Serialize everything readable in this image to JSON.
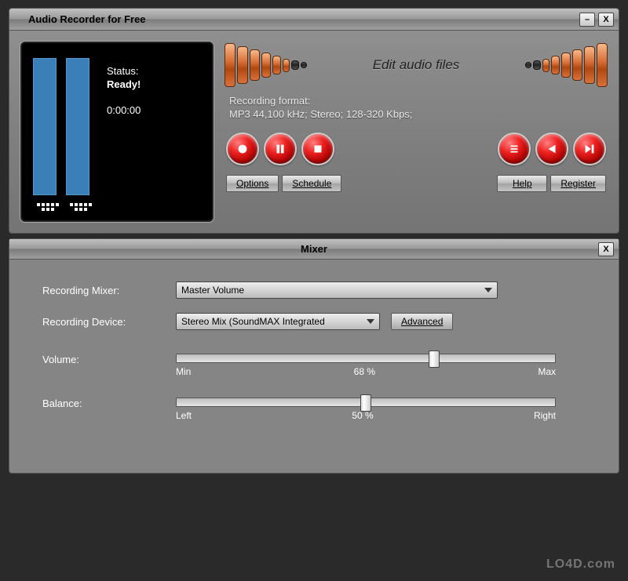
{
  "window": {
    "title": "Audio Recorder for Free"
  },
  "status": {
    "label": "Status:",
    "value": "Ready!",
    "time": "0:00:00"
  },
  "link": {
    "edit_audio": "Edit audio files"
  },
  "format": {
    "label": "Recording format:",
    "value": "MP3 44,100 kHz; Stereo;  128-320 Kbps;"
  },
  "buttons": {
    "options": "Options",
    "schedule": "Schedule",
    "help": "Help",
    "register": "Register",
    "advanced": "Advanced"
  },
  "mixer": {
    "title": "Mixer",
    "recording_mixer_label": "Recording Mixer:",
    "recording_mixer_value": "Master Volume",
    "recording_device_label": "Recording Device:",
    "recording_device_value": "Stereo Mix (SoundMAX Integrated",
    "volume": {
      "label": "Volume:",
      "min": "Min",
      "value_text": "68 %",
      "max": "Max",
      "percent": 68
    },
    "balance": {
      "label": "Balance:",
      "left": "Left",
      "value_text": "50 %",
      "right": "Right",
      "percent": 50
    }
  },
  "watermark": "LO4D.com"
}
